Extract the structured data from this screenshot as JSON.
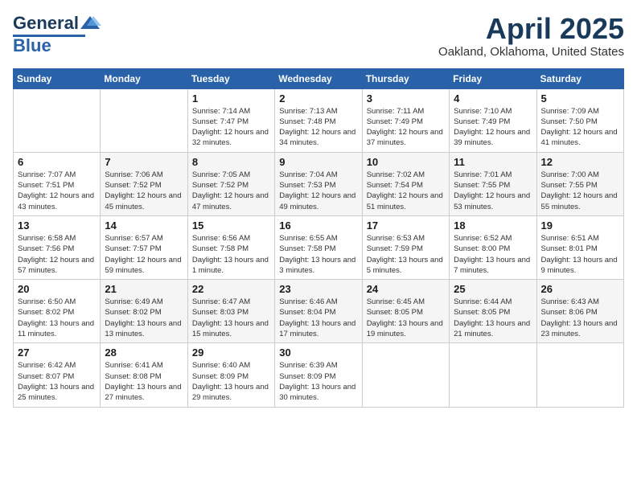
{
  "header": {
    "logo_line1": "General",
    "logo_line2": "Blue",
    "month_year": "April 2025",
    "location": "Oakland, Oklahoma, United States"
  },
  "days_of_week": [
    "Sunday",
    "Monday",
    "Tuesday",
    "Wednesday",
    "Thursday",
    "Friday",
    "Saturday"
  ],
  "weeks": [
    [
      {
        "day": "",
        "info": ""
      },
      {
        "day": "",
        "info": ""
      },
      {
        "day": "1",
        "sunrise": "Sunrise: 7:14 AM",
        "sunset": "Sunset: 7:47 PM",
        "daylight": "Daylight: 12 hours and 32 minutes."
      },
      {
        "day": "2",
        "sunrise": "Sunrise: 7:13 AM",
        "sunset": "Sunset: 7:48 PM",
        "daylight": "Daylight: 12 hours and 34 minutes."
      },
      {
        "day": "3",
        "sunrise": "Sunrise: 7:11 AM",
        "sunset": "Sunset: 7:49 PM",
        "daylight": "Daylight: 12 hours and 37 minutes."
      },
      {
        "day": "4",
        "sunrise": "Sunrise: 7:10 AM",
        "sunset": "Sunset: 7:49 PM",
        "daylight": "Daylight: 12 hours and 39 minutes."
      },
      {
        "day": "5",
        "sunrise": "Sunrise: 7:09 AM",
        "sunset": "Sunset: 7:50 PM",
        "daylight": "Daylight: 12 hours and 41 minutes."
      }
    ],
    [
      {
        "day": "6",
        "sunrise": "Sunrise: 7:07 AM",
        "sunset": "Sunset: 7:51 PM",
        "daylight": "Daylight: 12 hours and 43 minutes."
      },
      {
        "day": "7",
        "sunrise": "Sunrise: 7:06 AM",
        "sunset": "Sunset: 7:52 PM",
        "daylight": "Daylight: 12 hours and 45 minutes."
      },
      {
        "day": "8",
        "sunrise": "Sunrise: 7:05 AM",
        "sunset": "Sunset: 7:52 PM",
        "daylight": "Daylight: 12 hours and 47 minutes."
      },
      {
        "day": "9",
        "sunrise": "Sunrise: 7:04 AM",
        "sunset": "Sunset: 7:53 PM",
        "daylight": "Daylight: 12 hours and 49 minutes."
      },
      {
        "day": "10",
        "sunrise": "Sunrise: 7:02 AM",
        "sunset": "Sunset: 7:54 PM",
        "daylight": "Daylight: 12 hours and 51 minutes."
      },
      {
        "day": "11",
        "sunrise": "Sunrise: 7:01 AM",
        "sunset": "Sunset: 7:55 PM",
        "daylight": "Daylight: 12 hours and 53 minutes."
      },
      {
        "day": "12",
        "sunrise": "Sunrise: 7:00 AM",
        "sunset": "Sunset: 7:55 PM",
        "daylight": "Daylight: 12 hours and 55 minutes."
      }
    ],
    [
      {
        "day": "13",
        "sunrise": "Sunrise: 6:58 AM",
        "sunset": "Sunset: 7:56 PM",
        "daylight": "Daylight: 12 hours and 57 minutes."
      },
      {
        "day": "14",
        "sunrise": "Sunrise: 6:57 AM",
        "sunset": "Sunset: 7:57 PM",
        "daylight": "Daylight: 12 hours and 59 minutes."
      },
      {
        "day": "15",
        "sunrise": "Sunrise: 6:56 AM",
        "sunset": "Sunset: 7:58 PM",
        "daylight": "Daylight: 13 hours and 1 minute."
      },
      {
        "day": "16",
        "sunrise": "Sunrise: 6:55 AM",
        "sunset": "Sunset: 7:58 PM",
        "daylight": "Daylight: 13 hours and 3 minutes."
      },
      {
        "day": "17",
        "sunrise": "Sunrise: 6:53 AM",
        "sunset": "Sunset: 7:59 PM",
        "daylight": "Daylight: 13 hours and 5 minutes."
      },
      {
        "day": "18",
        "sunrise": "Sunrise: 6:52 AM",
        "sunset": "Sunset: 8:00 PM",
        "daylight": "Daylight: 13 hours and 7 minutes."
      },
      {
        "day": "19",
        "sunrise": "Sunrise: 6:51 AM",
        "sunset": "Sunset: 8:01 PM",
        "daylight": "Daylight: 13 hours and 9 minutes."
      }
    ],
    [
      {
        "day": "20",
        "sunrise": "Sunrise: 6:50 AM",
        "sunset": "Sunset: 8:02 PM",
        "daylight": "Daylight: 13 hours and 11 minutes."
      },
      {
        "day": "21",
        "sunrise": "Sunrise: 6:49 AM",
        "sunset": "Sunset: 8:02 PM",
        "daylight": "Daylight: 13 hours and 13 minutes."
      },
      {
        "day": "22",
        "sunrise": "Sunrise: 6:47 AM",
        "sunset": "Sunset: 8:03 PM",
        "daylight": "Daylight: 13 hours and 15 minutes."
      },
      {
        "day": "23",
        "sunrise": "Sunrise: 6:46 AM",
        "sunset": "Sunset: 8:04 PM",
        "daylight": "Daylight: 13 hours and 17 minutes."
      },
      {
        "day": "24",
        "sunrise": "Sunrise: 6:45 AM",
        "sunset": "Sunset: 8:05 PM",
        "daylight": "Daylight: 13 hours and 19 minutes."
      },
      {
        "day": "25",
        "sunrise": "Sunrise: 6:44 AM",
        "sunset": "Sunset: 8:05 PM",
        "daylight": "Daylight: 13 hours and 21 minutes."
      },
      {
        "day": "26",
        "sunrise": "Sunrise: 6:43 AM",
        "sunset": "Sunset: 8:06 PM",
        "daylight": "Daylight: 13 hours and 23 minutes."
      }
    ],
    [
      {
        "day": "27",
        "sunrise": "Sunrise: 6:42 AM",
        "sunset": "Sunset: 8:07 PM",
        "daylight": "Daylight: 13 hours and 25 minutes."
      },
      {
        "day": "28",
        "sunrise": "Sunrise: 6:41 AM",
        "sunset": "Sunset: 8:08 PM",
        "daylight": "Daylight: 13 hours and 27 minutes."
      },
      {
        "day": "29",
        "sunrise": "Sunrise: 6:40 AM",
        "sunset": "Sunset: 8:09 PM",
        "daylight": "Daylight: 13 hours and 29 minutes."
      },
      {
        "day": "30",
        "sunrise": "Sunrise: 6:39 AM",
        "sunset": "Sunset: 8:09 PM",
        "daylight": "Daylight: 13 hours and 30 minutes."
      },
      {
        "day": "",
        "info": ""
      },
      {
        "day": "",
        "info": ""
      },
      {
        "day": "",
        "info": ""
      }
    ]
  ]
}
